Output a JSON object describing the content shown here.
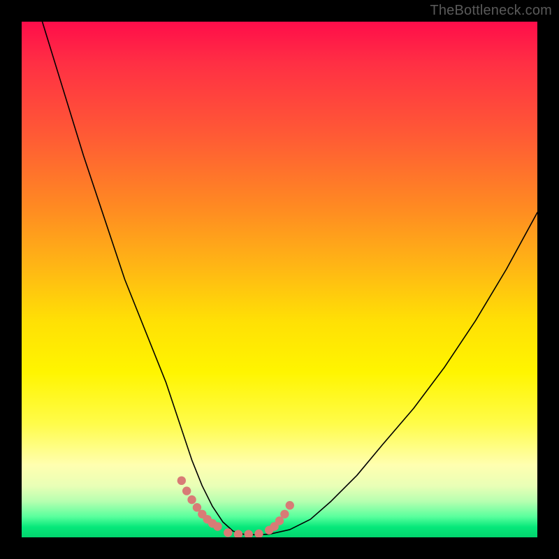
{
  "watermark": "TheBottleneck.com",
  "colors": {
    "background": "#000000",
    "curve": "#000000",
    "marker": "#d87b76"
  },
  "chart_data": {
    "type": "line",
    "title": "",
    "xlabel": "",
    "ylabel": "",
    "xlim": [
      0,
      100
    ],
    "ylim": [
      0,
      100
    ],
    "grid": false,
    "legend": false,
    "series": [
      {
        "name": "bottleneck-curve",
        "x": [
          4,
          8,
          12,
          16,
          20,
          24,
          28,
          31,
          33,
          35,
          37,
          39,
          41,
          43,
          45,
          48,
          52,
          56,
          60,
          65,
          70,
          76,
          82,
          88,
          94,
          100
        ],
        "y": [
          100,
          87,
          74,
          62,
          50,
          40,
          30,
          21,
          15,
          10,
          6,
          3,
          1.2,
          0.6,
          0.5,
          0.6,
          1.5,
          3.5,
          7,
          12,
          18,
          25,
          33,
          42,
          52,
          63
        ]
      }
    ],
    "markers": {
      "name": "highlight-dots",
      "x": [
        31,
        32,
        33,
        34,
        35,
        36,
        37,
        38,
        40,
        42,
        44,
        46,
        48,
        49,
        50,
        51,
        52
      ],
      "y": [
        11,
        9,
        7.3,
        5.8,
        4.5,
        3.5,
        2.7,
        2.1,
        0.9,
        0.6,
        0.6,
        0.7,
        1.4,
        2.1,
        3.2,
        4.5,
        6.2
      ]
    }
  }
}
